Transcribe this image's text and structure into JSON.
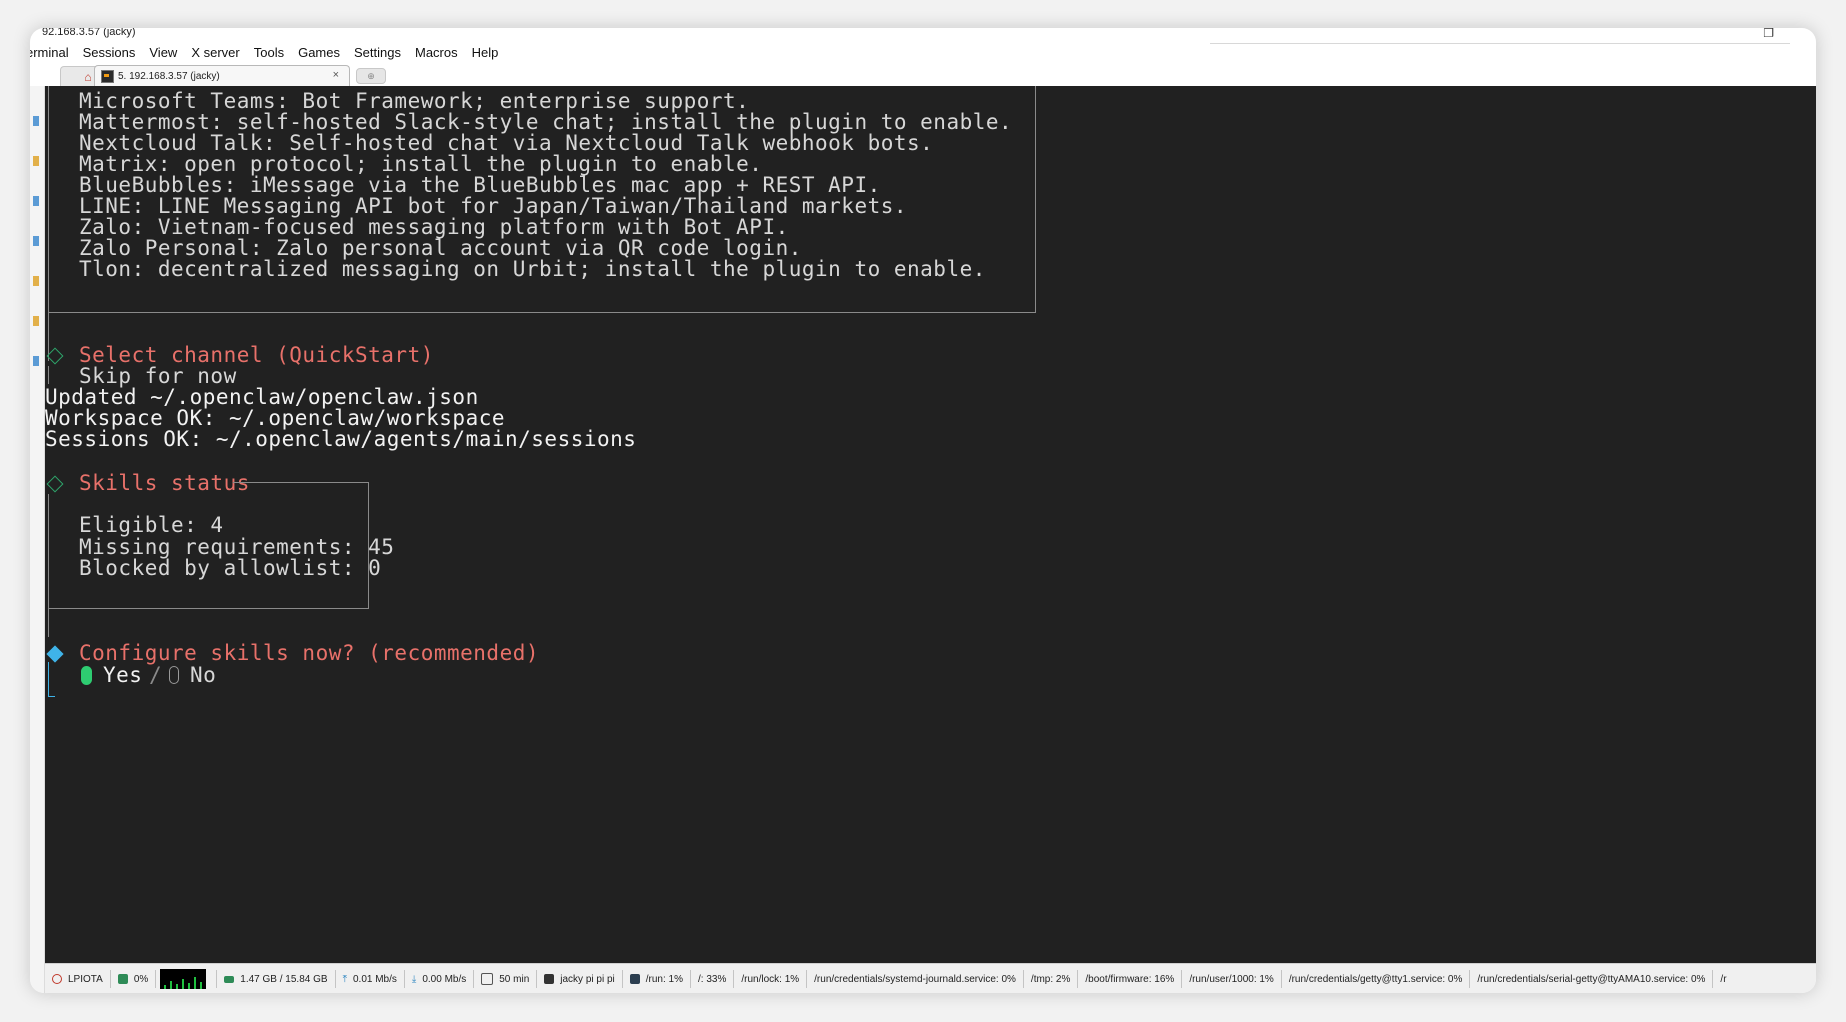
{
  "window": {
    "title": "92.168.3.57 (jacky)"
  },
  "menu": [
    "erminal",
    "Sessions",
    "View",
    "X server",
    "Tools",
    "Games",
    "Settings",
    "Macros",
    "Help"
  ],
  "tabs": {
    "active_label": "5. 192.168.3.57 (jacky)",
    "close_glyph": "×"
  },
  "terminal": {
    "channel_lines": [
      "Microsoft Teams: Bot Framework; enterprise support.",
      "Mattermost: self-hosted Slack-style chat; install the plugin to enable.",
      "Nextcloud Talk: Self-hosted chat via Nextcloud Talk webhook bots.",
      "Matrix: open protocol; install the plugin to enable.",
      "BlueBubbles: iMessage via the BlueBubbles mac app + REST API.",
      "LINE: LINE Messaging API bot for Japan/Taiwan/Thailand markets.",
      "Zalo: Vietnam-focused messaging platform with Bot API.",
      "Zalo Personal: Zalo personal account via QR code login.",
      "Tlon: decentralized messaging on Urbit; install the plugin to enable."
    ],
    "select_channel_title": "Select channel (QuickStart)",
    "select_channel_value": "Skip for now",
    "log_lines": [
      "Updated ~/.openclaw/openclaw.json",
      "Workspace OK: ~/.openclaw/workspace",
      "Sessions OK: ~/.openclaw/agents/main/sessions"
    ],
    "skills_title": "Skills status",
    "skills_lines": [
      "Eligible: 4",
      "Missing requirements: 45",
      "Blocked by allowlist: 0"
    ],
    "configure_prompt": "Configure skills now? (recommended)",
    "option_yes": "Yes",
    "option_separator": "/",
    "option_no": "No"
  },
  "status": {
    "host": "LPIOTA",
    "cpu": "0%",
    "memory": "1.47 GB / 15.84 GB",
    "upload": "0.01 Mb/s",
    "download": "0.00 Mb/s",
    "uptime": "50 min",
    "users": "jacky  pi  pi  pi",
    "disks": [
      "/run: 1%",
      "/: 33%",
      "/run/lock: 1%",
      "/run/credentials/systemd-journald.service: 0%",
      "/tmp: 2%",
      "/boot/firmware: 16%",
      "/run/user/1000: 1%",
      "/run/credentials/getty@tty1.service: 0%",
      "/run/credentials/serial-getty@ttyAMA10.service: 0%",
      "/r"
    ]
  }
}
